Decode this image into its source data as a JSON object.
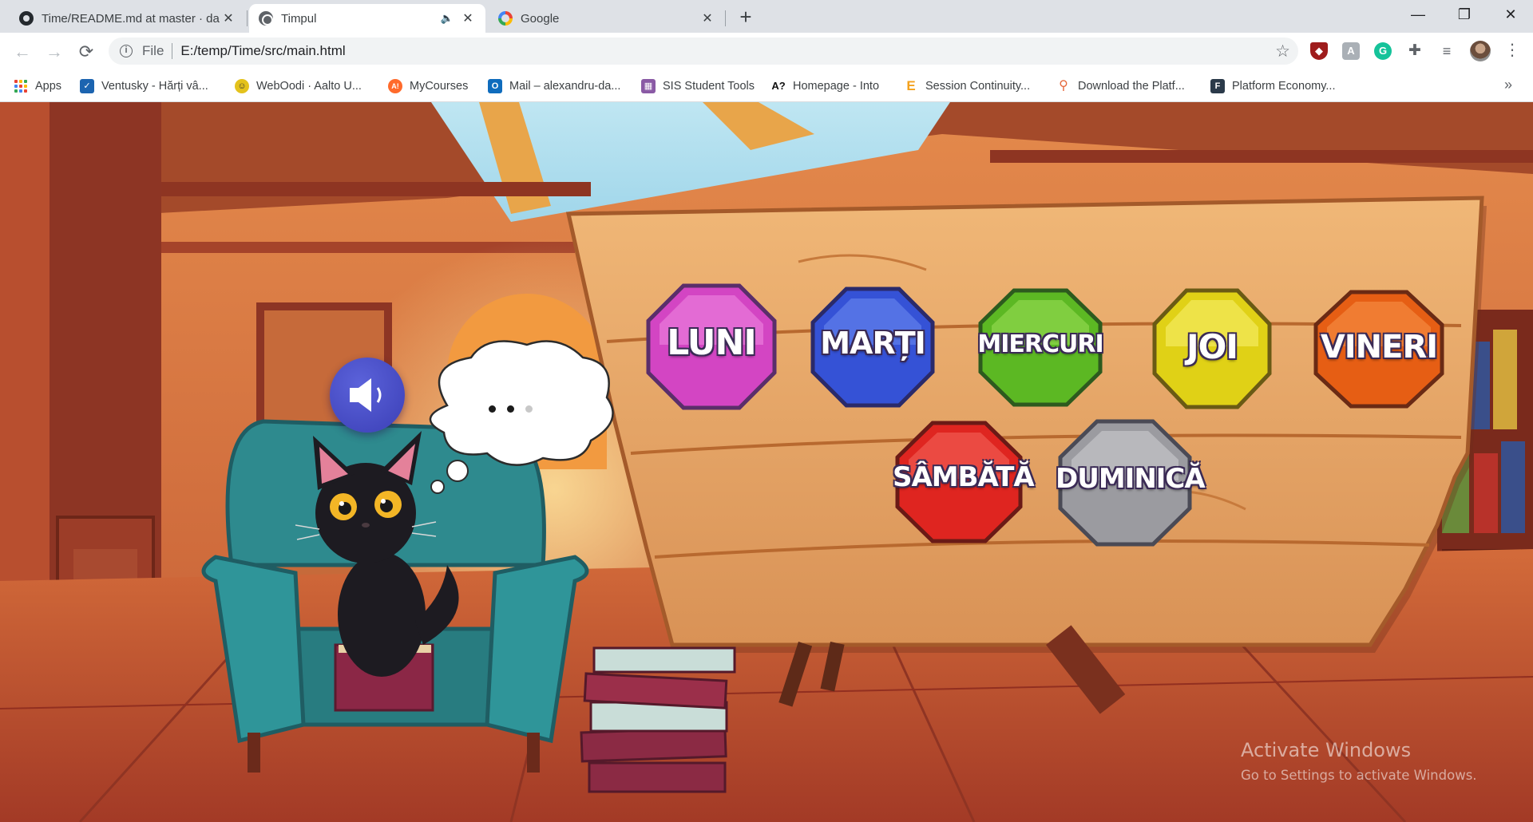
{
  "browser": {
    "tabs": [
      {
        "title": "Time/README.md at master · da",
        "favicon": "github-icon",
        "active": false
      },
      {
        "title": "Timpul",
        "favicon": "globe-icon",
        "active": true,
        "audio": true
      },
      {
        "title": "Google",
        "favicon": "google-icon",
        "active": false
      }
    ],
    "new_tab": "+",
    "window_controls": {
      "minimize": "—",
      "maximize": "❐",
      "close": "✕"
    },
    "nav": {
      "back": "←",
      "forward": "→",
      "reload": "⟳"
    },
    "address": {
      "scheme_label": "File",
      "url": "E:/temp/Time/src/main.html"
    },
    "bookmarks": [
      {
        "label": "Apps",
        "icon": "apps-grid-icon"
      },
      {
        "label": "Ventusky - Hărți vâ...",
        "icon": "ventusky-icon",
        "color": "#1c64b0"
      },
      {
        "label": "WebOodi · Aalto U...",
        "icon": "weboodi-icon",
        "color": "#e4c21c"
      },
      {
        "label": "MyCourses",
        "icon": "mycourses-icon",
        "color": "#ff6a2b"
      },
      {
        "label": "Mail – alexandru-da...",
        "icon": "outlook-icon",
        "color": "#0f6cbd"
      },
      {
        "label": "SIS Student Tools",
        "icon": "sis-icon",
        "color": "#8a5aa5"
      },
      {
        "label": "Homepage - Into",
        "icon": "into-icon",
        "color": "#111111"
      },
      {
        "label": "Session Continuity...",
        "icon": "session-icon",
        "color": "#f4a11c"
      },
      {
        "label": "Download the Platf...",
        "icon": "download-icon",
        "color": "#e5683c"
      },
      {
        "label": "Platform Economy...",
        "icon": "platform-icon",
        "color": "#2b3a4a"
      }
    ],
    "bookmarks_more": "»"
  },
  "game": {
    "thought_dots": 3,
    "days": [
      {
        "label": "LUNI",
        "color": "#e05cd0"
      },
      {
        "label": "MARȚI",
        "color": "#3f5fe0"
      },
      {
        "label": "MIERCURI",
        "color": "#6cc128"
      },
      {
        "label": "JOI",
        "color": "#e6dd18"
      },
      {
        "label": "VINERI",
        "color": "#ee6a18"
      },
      {
        "label": "SÂMBĂTĂ",
        "color": "#e32b22"
      },
      {
        "label": "DUMINICĂ",
        "color": "#a3a3a6"
      }
    ]
  },
  "os": {
    "watermark_title": "Activate Windows",
    "watermark_subtitle": "Go to Settings to activate Windows."
  }
}
